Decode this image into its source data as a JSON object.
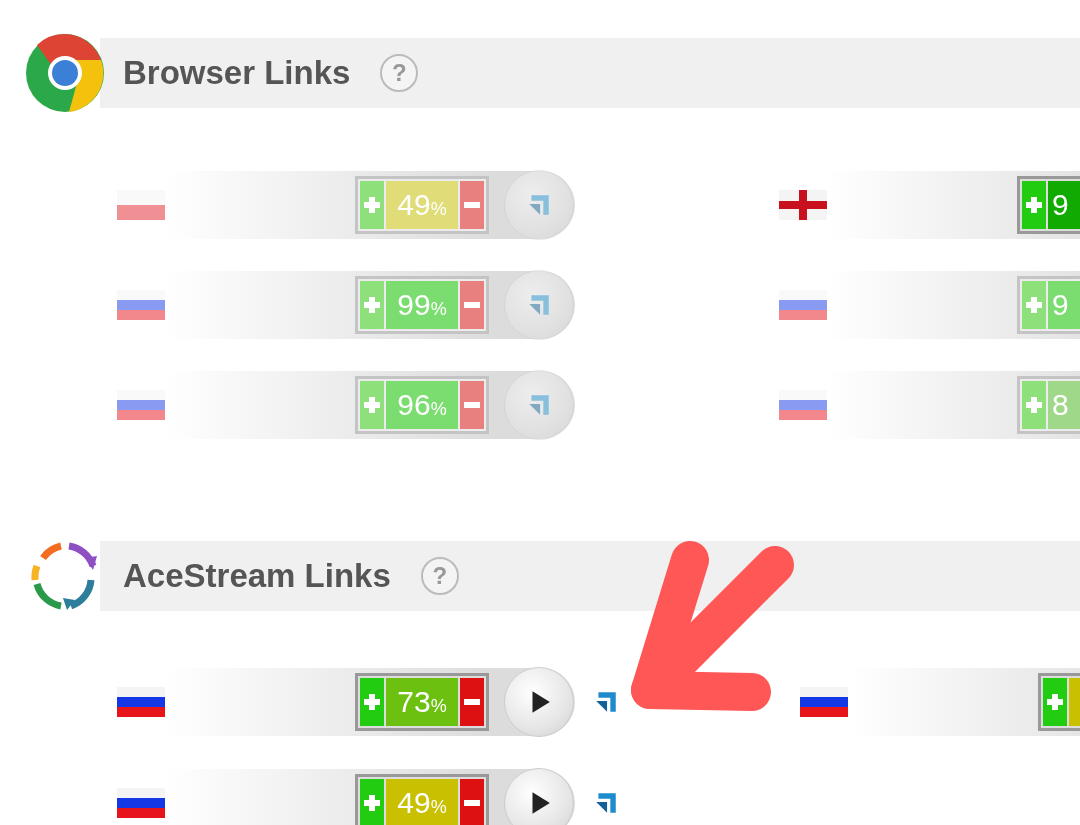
{
  "sections": [
    {
      "kind": "browser",
      "title": "Browser Links",
      "help": "?",
      "columns": [
        [
          {
            "kind": "pl",
            "value": "49",
            "unit": "%",
            "color": "#e0dc78",
            "dimmed": true
          },
          {
            "kind": "ru",
            "value": "99",
            "unit": "%",
            "color": "#7bdc70",
            "dimmed": true
          },
          {
            "kind": "ru",
            "value": "96",
            "unit": "%",
            "color": "#7bdc70",
            "dimmed": true
          }
        ],
        [
          {
            "kind": "en",
            "value": "9",
            "color": "#11aa00",
            "dimmed": false
          },
          {
            "kind": "ru",
            "value": "9",
            "color": "#7bdc70",
            "dimmed": true
          },
          {
            "kind": "ru",
            "value": "8",
            "color": "#9ed888",
            "dimmed": true
          }
        ]
      ]
    },
    {
      "kind": "acestream",
      "title": "AceStream Links",
      "help": "?",
      "columns": [
        [
          {
            "kind": "ru",
            "value": "73",
            "unit": "%",
            "color": "#6cc010",
            "dimmed": false
          },
          {
            "kind": "ru",
            "value": "49",
            "unit": "%",
            "color": "#c8c000",
            "dimmed": false
          }
        ],
        [
          {
            "kind": "ru",
            "color": "#c8c000",
            "dimmed": false
          }
        ]
      ]
    }
  ]
}
